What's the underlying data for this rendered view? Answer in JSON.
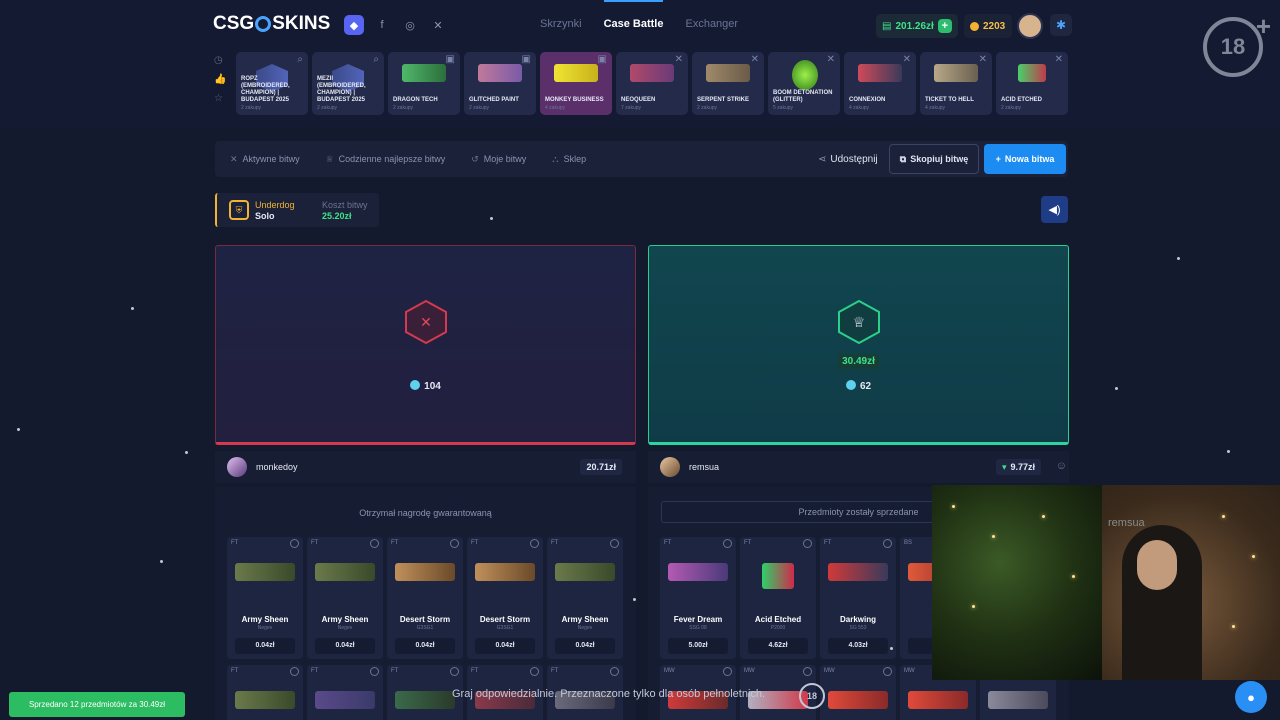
{
  "brand": {
    "logo_left": "CSG",
    "logo_right": "SKINS"
  },
  "socials": [
    "discord-icon",
    "facebook-icon",
    "instagram-icon",
    "x-icon"
  ],
  "nav": {
    "items": [
      "Skrzynki",
      "Case Battle",
      "Exchanger"
    ],
    "active": "Case Battle"
  },
  "account": {
    "balance": "201.26zł",
    "coins": "2203"
  },
  "age_badge": "18",
  "cases": [
    {
      "name": "RopZ (Embroidered, Champion) | Budapest 2025",
      "sub": "2 zakupy"
    },
    {
      "name": "mezii (Embroidered, Champion) | Budapest 2025",
      "sub": "2 zakupy"
    },
    {
      "name": "Dragon Tech",
      "sub": "2 zakupy"
    },
    {
      "name": "Glitched Paint",
      "sub": "2 zakupy"
    },
    {
      "name": "Monkey Business",
      "sub": "4 zakupy"
    },
    {
      "name": "Neoqueen",
      "sub": "7 zakupy"
    },
    {
      "name": "Serpent Strike",
      "sub": "2 zakupy"
    },
    {
      "name": "Boom Detonation (Glitter)",
      "sub": "5 zakupy"
    },
    {
      "name": "Connexion",
      "sub": "4 zakupy"
    },
    {
      "name": "Ticket to Hell",
      "sub": "4 zakupy"
    },
    {
      "name": "Acid Etched",
      "sub": "2 zakupy"
    }
  ],
  "subnav": {
    "tabs": [
      "Aktywne bitwy",
      "Codzienne najlepsze bitwy",
      "Moje bitwy",
      "Sklep"
    ],
    "share": "Udostępnij",
    "copy": "Skopiuj bitwę",
    "new_battle": "Nowa bitwa"
  },
  "battle": {
    "mode_label": "Underdog",
    "mode_value": "Solo",
    "cost_label": "Koszt bitwy",
    "cost_value": "25.20zł"
  },
  "players": {
    "left": {
      "name": "monkedoy",
      "value": "20.71zł",
      "gems": "104",
      "banner": "Otrzymał nagrodę gwarantowaną"
    },
    "right": {
      "name": "remsua",
      "value": "9.77zł",
      "prize": "30.49zł",
      "gems": "62",
      "banner": "Przedmioty zostały sprzedane"
    }
  },
  "left_items": [
    {
      "wear": "FT",
      "name": "Army Sheen",
      "weapon": "Negev",
      "price": "0.04zł"
    },
    {
      "wear": "FT",
      "name": "Army Sheen",
      "weapon": "Negev",
      "price": "0.04zł"
    },
    {
      "wear": "FT",
      "name": "Desert Storm",
      "weapon": "G3SG1",
      "price": "0.04zł"
    },
    {
      "wear": "FT",
      "name": "Desert Storm",
      "weapon": "G3SG1",
      "price": "0.04zł"
    },
    {
      "wear": "FT",
      "name": "Army Sheen",
      "weapon": "Negev",
      "price": "0.04zł"
    }
  ],
  "right_items": [
    {
      "wear": "FT",
      "name": "Fever Dream",
      "weapon": "SSG 08",
      "price": "5.00zł"
    },
    {
      "wear": "FT",
      "name": "Acid Etched",
      "weapon": "P2000",
      "price": "4.62zł"
    },
    {
      "wear": "FT",
      "name": "Darkwing",
      "weapon": "SG 553",
      "price": "4.03zł"
    },
    {
      "wear": "BS",
      "name": "Li",
      "weapon": "",
      "price": "3"
    }
  ],
  "row2_wear_left": [
    "FT",
    "FT",
    "FT",
    "FT",
    "FT"
  ],
  "row2_wear_right": [
    "MW",
    "MW",
    "MW",
    "MW",
    "MW"
  ],
  "toast": "Sprzedano 12 przedmiotów za 30.49zł",
  "footer": {
    "note": "Graj odpowiedzialnie. Przeznaczone tylko dla osób pełnoletnich.",
    "badge": "18"
  },
  "webcam_overlay": "remsua"
}
